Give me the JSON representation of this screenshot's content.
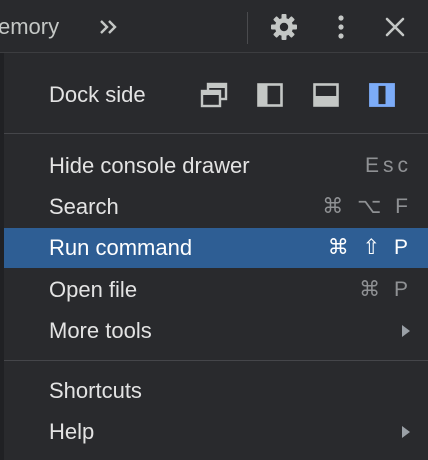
{
  "toolbar": {
    "visible_tab_label": "emory",
    "overflow_icon": "double-chevron-right-icon",
    "settings_icon": "gear-icon",
    "more_icon": "kebab-vertical-icon",
    "close_icon": "close-icon"
  },
  "menu": {
    "dock_side": {
      "label": "Dock side",
      "options": [
        {
          "icon": "undock-into-separate-window-icon",
          "selected": false
        },
        {
          "icon": "dock-to-left-icon",
          "selected": false
        },
        {
          "icon": "dock-to-bottom-icon",
          "selected": false
        },
        {
          "icon": "dock-to-right-icon",
          "selected": true
        }
      ]
    },
    "items": [
      {
        "label": "Hide console drawer",
        "shortcut": "Esc"
      },
      {
        "label": "Search",
        "shortcut": "⌘ ⌥ F"
      },
      {
        "label": "Run command",
        "shortcut": "⌘ ⇧ P",
        "highlighted": true
      },
      {
        "label": "Open file",
        "shortcut": "⌘ P"
      },
      {
        "label": "More tools",
        "submenu": true
      },
      {
        "label": "Shortcuts"
      },
      {
        "label": "Help",
        "submenu": true
      }
    ]
  },
  "colors": {
    "background": "#292a2d",
    "highlight": "#2e5e94",
    "selected_dock": "#7cacf8",
    "text": "#e3e3e3",
    "shortcut_text": "#8f9194"
  }
}
